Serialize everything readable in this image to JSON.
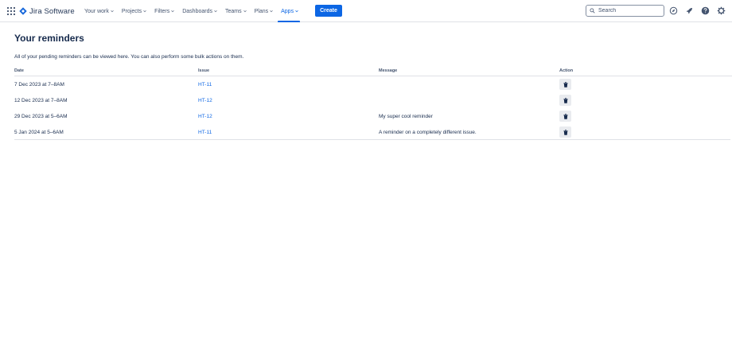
{
  "app": {
    "name": "Jira Software"
  },
  "nav": {
    "items": [
      {
        "label": "Your work"
      },
      {
        "label": "Projects"
      },
      {
        "label": "Filters"
      },
      {
        "label": "Dashboards"
      },
      {
        "label": "Teams"
      },
      {
        "label": "Plans"
      },
      {
        "label": "Apps"
      }
    ],
    "active_item": "Apps",
    "create_label": "Create",
    "search_placeholder": "Search",
    "icons": [
      "notifications-icon",
      "whats-new-icon",
      "help-icon",
      "settings-icon"
    ],
    "accent_color": "#0c66e4"
  },
  "page": {
    "title": "Your reminders",
    "description": "All of your pending reminders can be viewed here. You can also perform some bulk actions on them."
  },
  "table": {
    "headers": {
      "date": "Date",
      "issue": "Issue",
      "message": "Message",
      "action": "Action"
    },
    "rows": [
      {
        "date": "7 Dec 2023 at 7–8AM",
        "issue": "HT-11",
        "message": "",
        "action_icon": "trash-icon"
      },
      {
        "date": "12 Dec 2023 at 7–8AM",
        "issue": "HT-12",
        "message": "",
        "action_icon": "trash-icon"
      },
      {
        "date": "29 Dec 2023 at 5–6AM",
        "issue": "HT-12",
        "message": "My super cool reminder",
        "action_icon": "trash-icon"
      },
      {
        "date": "5 Jan 2024 at 5–6AM",
        "issue": "HT-11",
        "message": "A reminder on a completely different issue.",
        "action_icon": "trash-icon"
      }
    ]
  }
}
